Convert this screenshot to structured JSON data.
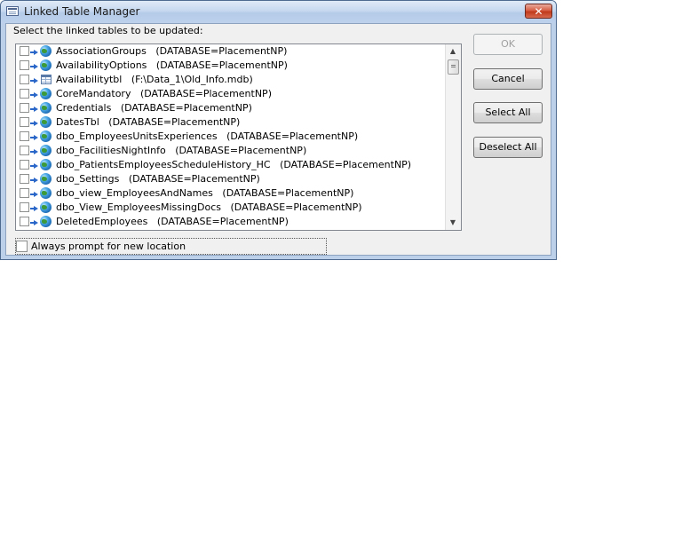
{
  "window": {
    "title": "Linked Table Manager",
    "close_glyph": "✕"
  },
  "prompt": {
    "text": "Select the linked tables to be updated:"
  },
  "tables": [
    {
      "name": "AssociationGroups",
      "source": "(DATABASE=PlacementNP)",
      "icon": "globe-icon",
      "checked": false
    },
    {
      "name": "AvailabilityOptions",
      "source": "(DATABASE=PlacementNP)",
      "icon": "globe-icon",
      "checked": false
    },
    {
      "name": "Availabilitytbl",
      "source": "(F:\\Data_1\\Old_Info.mdb)",
      "icon": "table-icon",
      "checked": false
    },
    {
      "name": "CoreMandatory",
      "source": "(DATABASE=PlacementNP)",
      "icon": "globe-icon",
      "checked": false
    },
    {
      "name": "Credentials",
      "source": "(DATABASE=PlacementNP)",
      "icon": "globe-icon",
      "checked": false
    },
    {
      "name": "DatesTbl",
      "source": "(DATABASE=PlacementNP)",
      "icon": "globe-icon",
      "checked": false
    },
    {
      "name": "dbo_EmployeesUnitsExperiences",
      "source": "(DATABASE=PlacementNP)",
      "icon": "globe-icon",
      "checked": false
    },
    {
      "name": "dbo_FacilitiesNightInfo",
      "source": "(DATABASE=PlacementNP)",
      "icon": "globe-icon",
      "checked": false
    },
    {
      "name": "dbo_PatientsEmployeesScheduleHistory_HC",
      "source": "(DATABASE=PlacementNP)",
      "icon": "globe-icon",
      "checked": false
    },
    {
      "name": "dbo_Settings",
      "source": "(DATABASE=PlacementNP)",
      "icon": "globe-icon",
      "checked": false
    },
    {
      "name": "dbo_view_EmployeesAndNames",
      "source": "(DATABASE=PlacementNP)",
      "icon": "globe-icon",
      "checked": false
    },
    {
      "name": "dbo_View_EmployeesMissingDocs",
      "source": "(DATABASE=PlacementNP)",
      "icon": "globe-icon",
      "checked": false
    },
    {
      "name": "DeletedEmployees",
      "source": "(DATABASE=PlacementNP)",
      "icon": "globe-icon",
      "checked": false
    }
  ],
  "buttons": {
    "ok": "OK",
    "cancel": "Cancel",
    "select_all": "Select All",
    "deselect_all": "Deselect All"
  },
  "options": {
    "always_prompt_label": "Always prompt for new location",
    "always_prompt_checked": false
  },
  "scrollbar": {
    "up_glyph": "▲",
    "down_glyph": "▼"
  }
}
